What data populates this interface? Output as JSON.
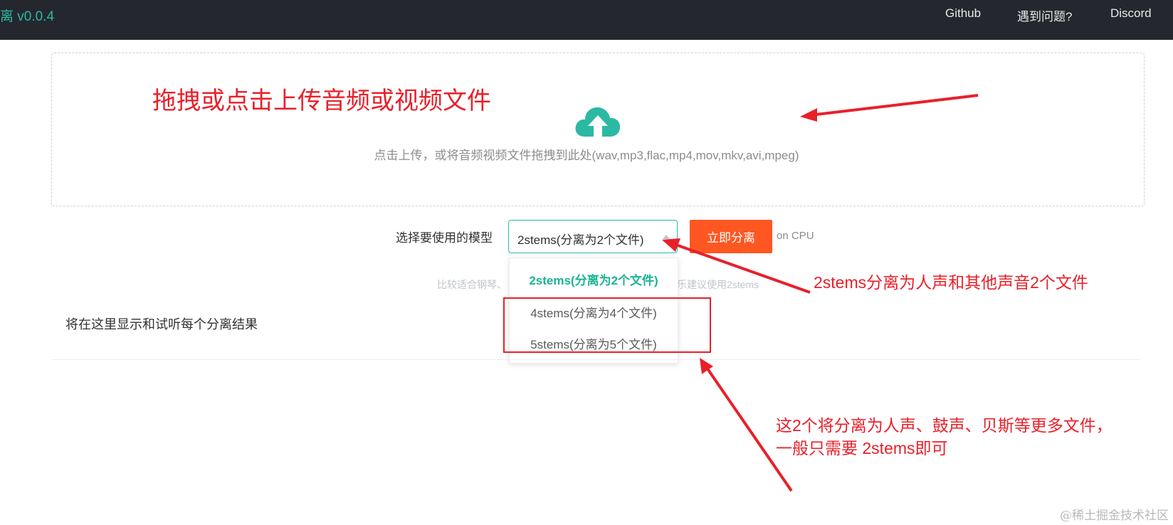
{
  "header": {
    "brand": "离 v0.0.4",
    "nav": [
      "Github",
      "遇到问题?",
      "Discord"
    ]
  },
  "upload": {
    "icon": "cloud-upload-icon",
    "text": "点击上传，或将音频视频文件拖拽到此处(wav,mp3,flac,mp4,mov,mkv,avi,mpeg)"
  },
  "model": {
    "label": "选择要使用的模型",
    "selected": "2stems(分离为2个文件)",
    "options": [
      "2stems(分离为2个文件)",
      "4stems(分离为4个文件)",
      "5stems(分离为5个文件)"
    ],
    "run_button": "立即分离",
    "device": "on CPU",
    "hint_left": "比较适合钢琴、",
    "hint_right": "乐建议使用2stems"
  },
  "results": {
    "placeholder": "将在这里显示和试听每个分离结果"
  },
  "annotations": {
    "upload_note": "拖拽或点击上传音频或视频文件",
    "stems2_note": "2stems分离为人声和其他声音2个文件",
    "stems_more_note_line1": "这2个将分离为人声、鼓声、贝斯等更多文件，",
    "stems_more_note_line2": "一般只需要 2stems即可"
  },
  "watermark": "@稀土掘金技术社区",
  "colors": {
    "topbar": "#24282e",
    "accent": "#2cb9a4",
    "button": "#ff5722",
    "annotation": "#e8202a"
  }
}
